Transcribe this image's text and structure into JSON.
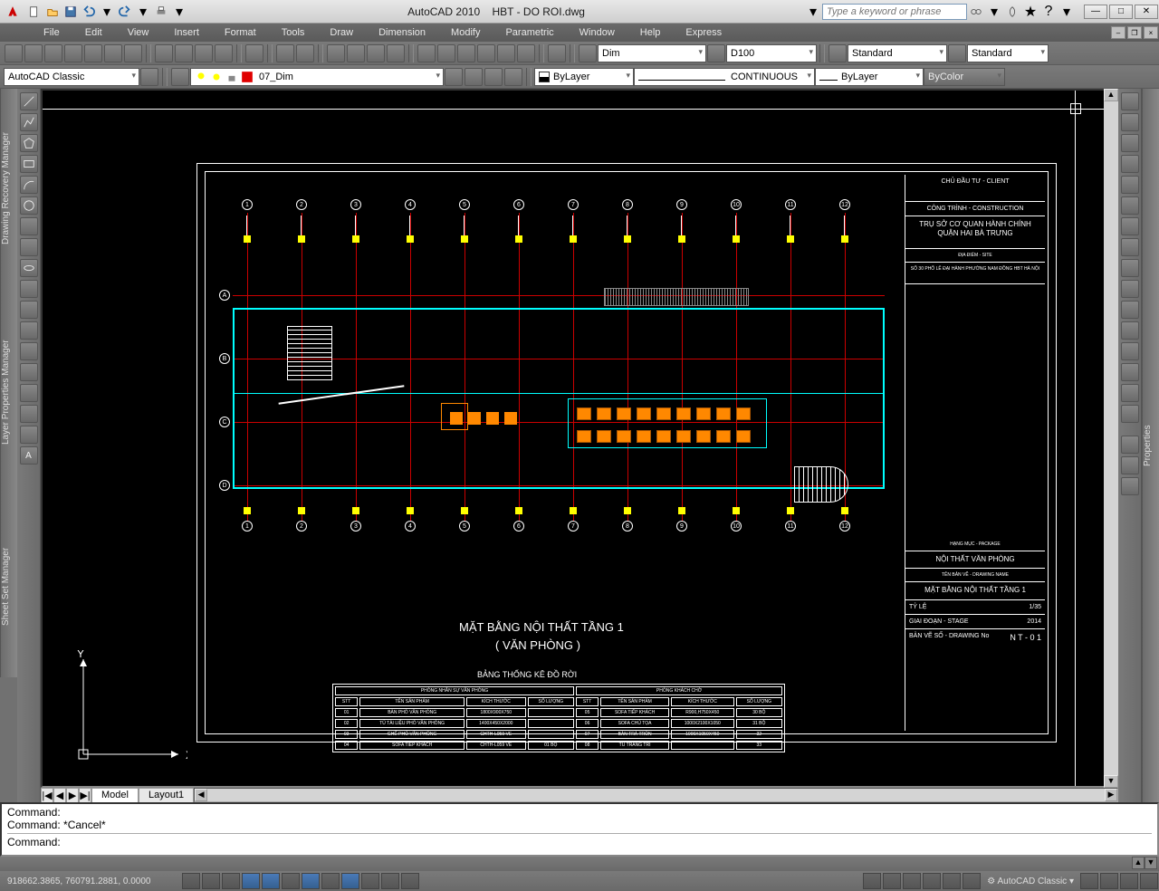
{
  "app": {
    "name": "AutoCAD 2010",
    "file": "HBT - DO ROI.dwg"
  },
  "search_placeholder": "Type a keyword or phrase",
  "menus": [
    "File",
    "Edit",
    "View",
    "Insert",
    "Format",
    "Tools",
    "Draw",
    "Dimension",
    "Modify",
    "Parametric",
    "Window",
    "Help",
    "Express"
  ],
  "workspace": "AutoCAD Classic",
  "layer_current": "07_Dim",
  "dimstyle": "Dim",
  "scale": "D100",
  "textstyle": "Standard",
  "tablestyle": "Standard",
  "color": "ByLayer",
  "linetype": "CONTINUOUS",
  "lineweight": "ByLayer",
  "plotstyle": "ByColor",
  "tabs": {
    "nav": [
      "|◀",
      "◀",
      "▶",
      "▶|"
    ],
    "model": "Model",
    "layout1": "Layout1"
  },
  "vtabs": [
    "Drawing Recovery Manager",
    "Layer Properties Manager",
    "Sheet Set Manager"
  ],
  "vtabs_right": "Properties",
  "cmd": {
    "l1": "Command:",
    "l2": "Command: *Cancel*",
    "prompt": "Command:"
  },
  "coords": "918662.3865, 760791.2881, 0.0000",
  "ucs": {
    "x": "X",
    "y": "Y"
  },
  "drawing": {
    "title": "MẶT BẰNG NỘI THẤT TẦNG 1",
    "subtitle": "( VĂN PHÒNG )",
    "schedule_title": "BẢNG THỐNG KÊ ĐỒ RỜI",
    "titleblock": {
      "t1": "CHỦ ĐẦU TƯ - CLIENT",
      "t2": "CÔNG TRÌNH - CONSTRUCTION",
      "t3": "TRỤ SỞ CƠ QUAN HÀNH CHÍNH QUẬN HAI BÀ TRƯNG",
      "t4": "ĐỊA ĐIỂM - SITE",
      "t5": "SỐ 30 PHỐ LÊ ĐẠI HÀNH PHƯỜNG NAM ĐỒNG HBT HÀ NỘI",
      "t6": "HẠNG MỤC - PACKAGE",
      "t7": "NỘI THẤT VĂN PHÒNG",
      "t8": "TÊN BẢN VẼ - DRAWING NAME",
      "t9": "MẶT BẰNG NỘI THẤT TẦNG 1",
      "t10": "TỶ LỆ",
      "t10v": "1/35",
      "t11": "GIAI ĐOẠN - STAGE",
      "t11v": "2014",
      "t12": "BẢN VẼ SỐ - DRAWING No",
      "t12v": "N T - 0 1"
    },
    "schedule": {
      "head_left": "PHÒNG NHÂN SỰ VĂN PHÒNG",
      "head_right": "PHÒNG KHÁCH CHỜ",
      "cols": [
        "STT",
        "TÊN SẢN PHẨM",
        "KÍCH THƯỚC",
        "SỐ LƯỢNG",
        "STT",
        "TÊN SẢN PHẨM",
        "KÍCH THƯỚC",
        "SỐ LƯỢNG"
      ],
      "rows": [
        [
          "01",
          "BÀN PHÓ VĂN PHÒNG",
          "1800X900X750",
          "",
          "05",
          "SOFA TIẾP KHÁCH",
          "R900,H750X450",
          "30 BỘ"
        ],
        [
          "02",
          "TỦ TÀI LIỆU PHÓ VĂN PHÒNG",
          "1400X450X2000",
          "",
          "06",
          "SOFA CHỦ TỌA",
          "1000X2100X1050",
          "31 BỘ"
        ],
        [
          "03",
          "GHẾ PHÓ VĂN PHÒNG",
          "CHTH-L059 VE",
          "",
          "07",
          "BÀN TRÀ TRÒN",
          "1000X1050X450",
          "32"
        ],
        [
          "04",
          "SOFA TIẾP KHÁCH",
          "CHTH-L059 VE",
          "01 BỘ",
          "08",
          "TỦ TRANG TRÍ",
          "",
          "33"
        ]
      ]
    },
    "grid_labels_top": [
      "1",
      "2",
      "3",
      "4",
      "5",
      "6",
      "7",
      "8",
      "9",
      "10",
      "11",
      "12"
    ],
    "grid_labels_left": [
      "A",
      "B",
      "C",
      "D"
    ]
  }
}
